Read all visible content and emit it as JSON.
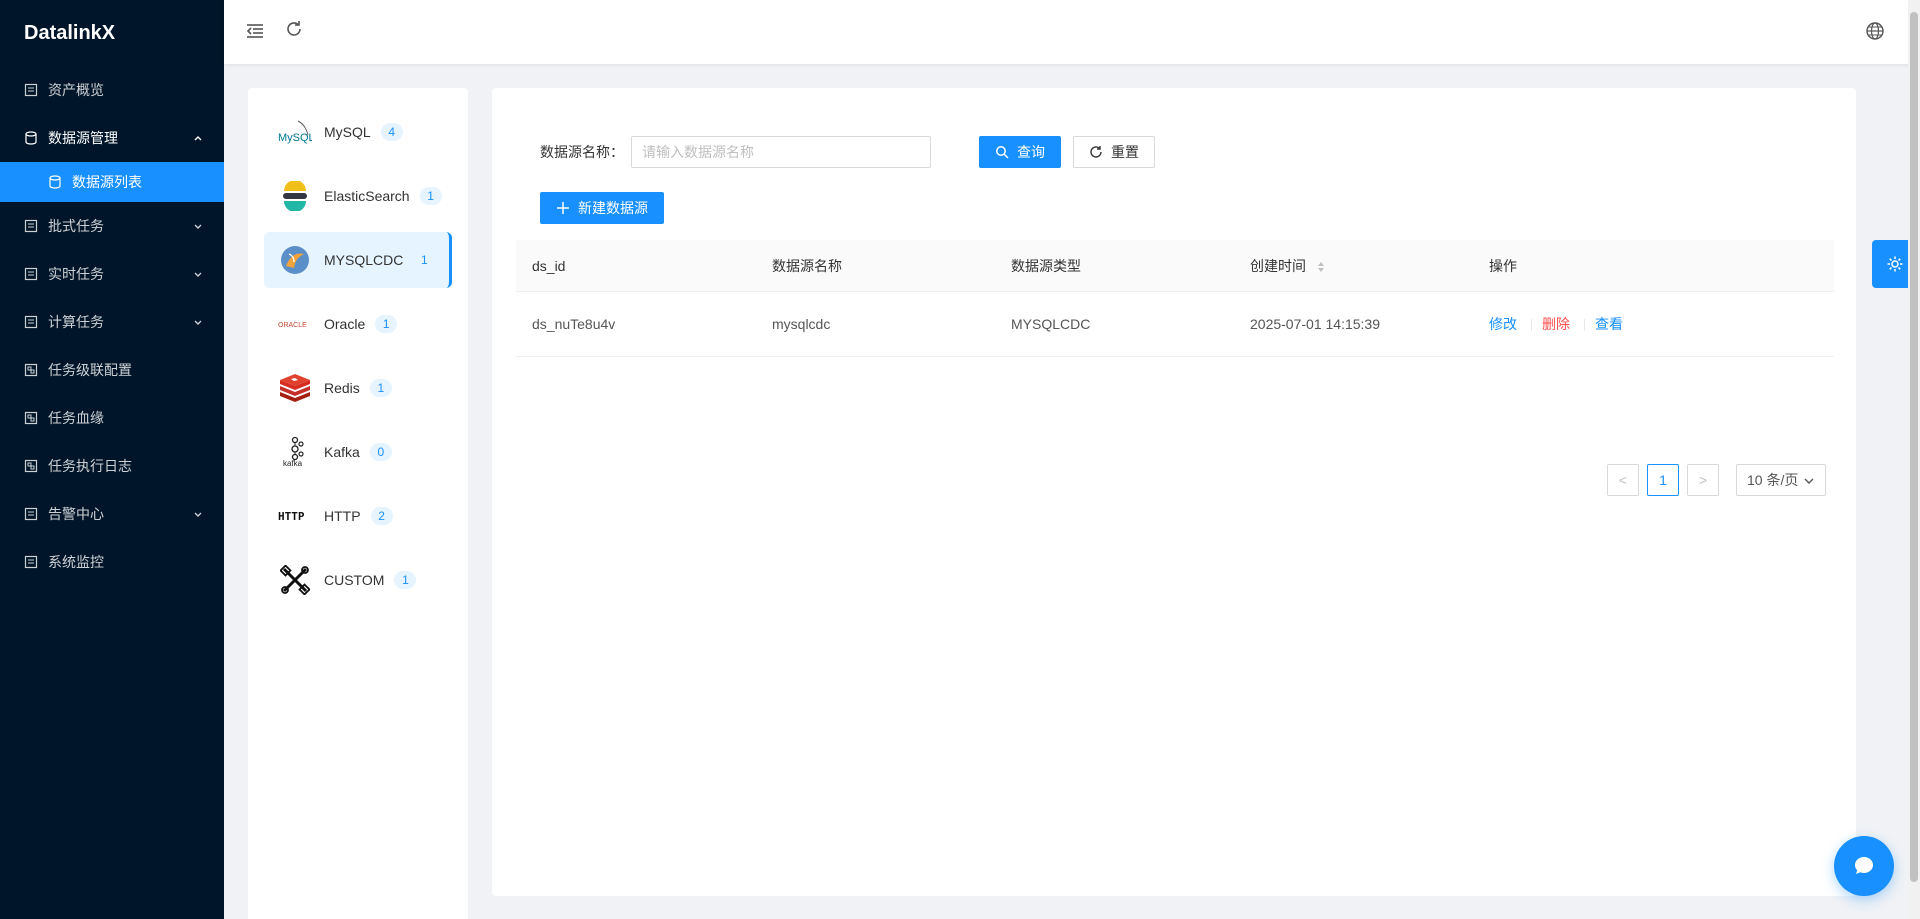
{
  "app": {
    "title": "DatalinkX"
  },
  "sidebar": {
    "items": [
      {
        "label": "资产概览"
      },
      {
        "label": "数据源管理",
        "open": true,
        "children": [
          {
            "label": "数据源列表"
          }
        ]
      },
      {
        "label": "批式任务"
      },
      {
        "label": "实时任务"
      },
      {
        "label": "计算任务"
      },
      {
        "label": "任务级联配置"
      },
      {
        "label": "任务血缘"
      },
      {
        "label": "任务执行日志"
      },
      {
        "label": "告警中心"
      },
      {
        "label": "系统监控"
      }
    ]
  },
  "header": {
    "collapse_icon": "menu-fold-icon",
    "refresh_icon": "reload-icon",
    "lang_icon": "global-icon"
  },
  "types": [
    {
      "name": "MySQL",
      "count": "4"
    },
    {
      "name": "ElasticSearch",
      "count": "1"
    },
    {
      "name": "MYSQLCDC",
      "count": "1"
    },
    {
      "name": "Oracle",
      "count": "1"
    },
    {
      "name": "Redis",
      "count": "1"
    },
    {
      "name": "Kafka",
      "count": "0"
    },
    {
      "name": "HTTP",
      "count": "2"
    },
    {
      "name": "CUSTOM",
      "count": "1"
    }
  ],
  "logos": {
    "mysql_text": "MySQL",
    "oracle_text": "ORACLE",
    "kafka_text": "kafka",
    "http_text": "HTTP"
  },
  "search": {
    "label": "数据源名称：",
    "placeholder": "请输入数据源名称",
    "query_label": "查询",
    "reset_label": "重置",
    "new_label": "新建数据源"
  },
  "table": {
    "columns": [
      "ds_id",
      "数据源名称",
      "数据源类型",
      "创建时间",
      "操作"
    ],
    "rows": [
      {
        "ds_id": "ds_nuTe8u4v",
        "name": "mysqlcdc",
        "type": "MYSQLCDC",
        "created": "2025-07-01 14:15:39"
      }
    ],
    "actions": {
      "edit": "修改",
      "delete": "删除",
      "view": "查看"
    }
  },
  "pagination": {
    "prev": "<",
    "current": "1",
    "next": ">",
    "page_size": "10 条/页"
  },
  "colors": {
    "primary": "#1890ff",
    "danger": "#ff4d4f",
    "sidebar_bg": "#001529"
  }
}
